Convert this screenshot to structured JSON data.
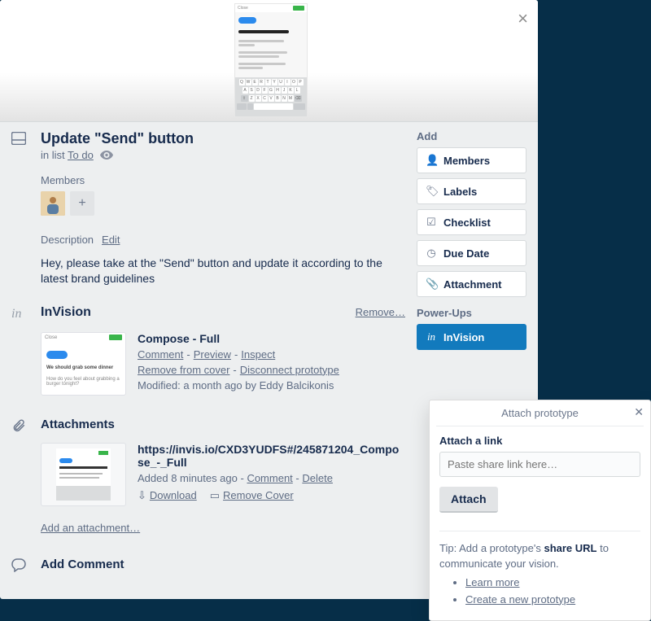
{
  "card": {
    "title": "Update \"Send\" button",
    "in_list_prefix": "in list",
    "list_name": "To do"
  },
  "members": {
    "heading": "Members"
  },
  "description": {
    "heading": "Description",
    "edit": "Edit",
    "text": "Hey, please take at the \"Send\" button and update it according to the latest brand guidelines"
  },
  "invision": {
    "title": "InVision",
    "remove": "Remove…",
    "item": {
      "name": "Compose - Full",
      "actions": {
        "comment": "Comment",
        "preview": "Preview",
        "inspect": "Inspect"
      },
      "secondary": {
        "remove_cover": "Remove from cover",
        "disconnect": "Disconnect prototype"
      },
      "modified": "Modified: a month ago by Eddy Balcikonis"
    }
  },
  "attachments": {
    "title": "Attachments",
    "item": {
      "url": "https://invis.io/CXD3YUDFS#/245871204_Compose_-_Full",
      "added": "Added 8 minutes ago",
      "comment": "Comment",
      "delete": "Delete",
      "download": "Download",
      "remove_cover": "Remove Cover"
    },
    "add": "Add an attachment…"
  },
  "comment": {
    "title": "Add Comment"
  },
  "sidebar": {
    "add_heading": "Add",
    "items": [
      {
        "icon": "user",
        "label": "Members"
      },
      {
        "icon": "tag",
        "label": "Labels"
      },
      {
        "icon": "check",
        "label": "Checklist"
      },
      {
        "icon": "clock",
        "label": "Due Date"
      },
      {
        "icon": "clip",
        "label": "Attachment"
      }
    ],
    "powerups_heading": "Power-Ups",
    "powerup": {
      "label": "InVision"
    }
  },
  "popover": {
    "title": "Attach prototype",
    "label": "Attach a link",
    "placeholder": "Paste share link here…",
    "button": "Attach",
    "tip_prefix": "Tip: Add a prototype's ",
    "tip_bold": "share URL",
    "tip_suffix": " to communicate your vision.",
    "learn_more": "Learn more",
    "create_new": "Create a new prototype"
  }
}
